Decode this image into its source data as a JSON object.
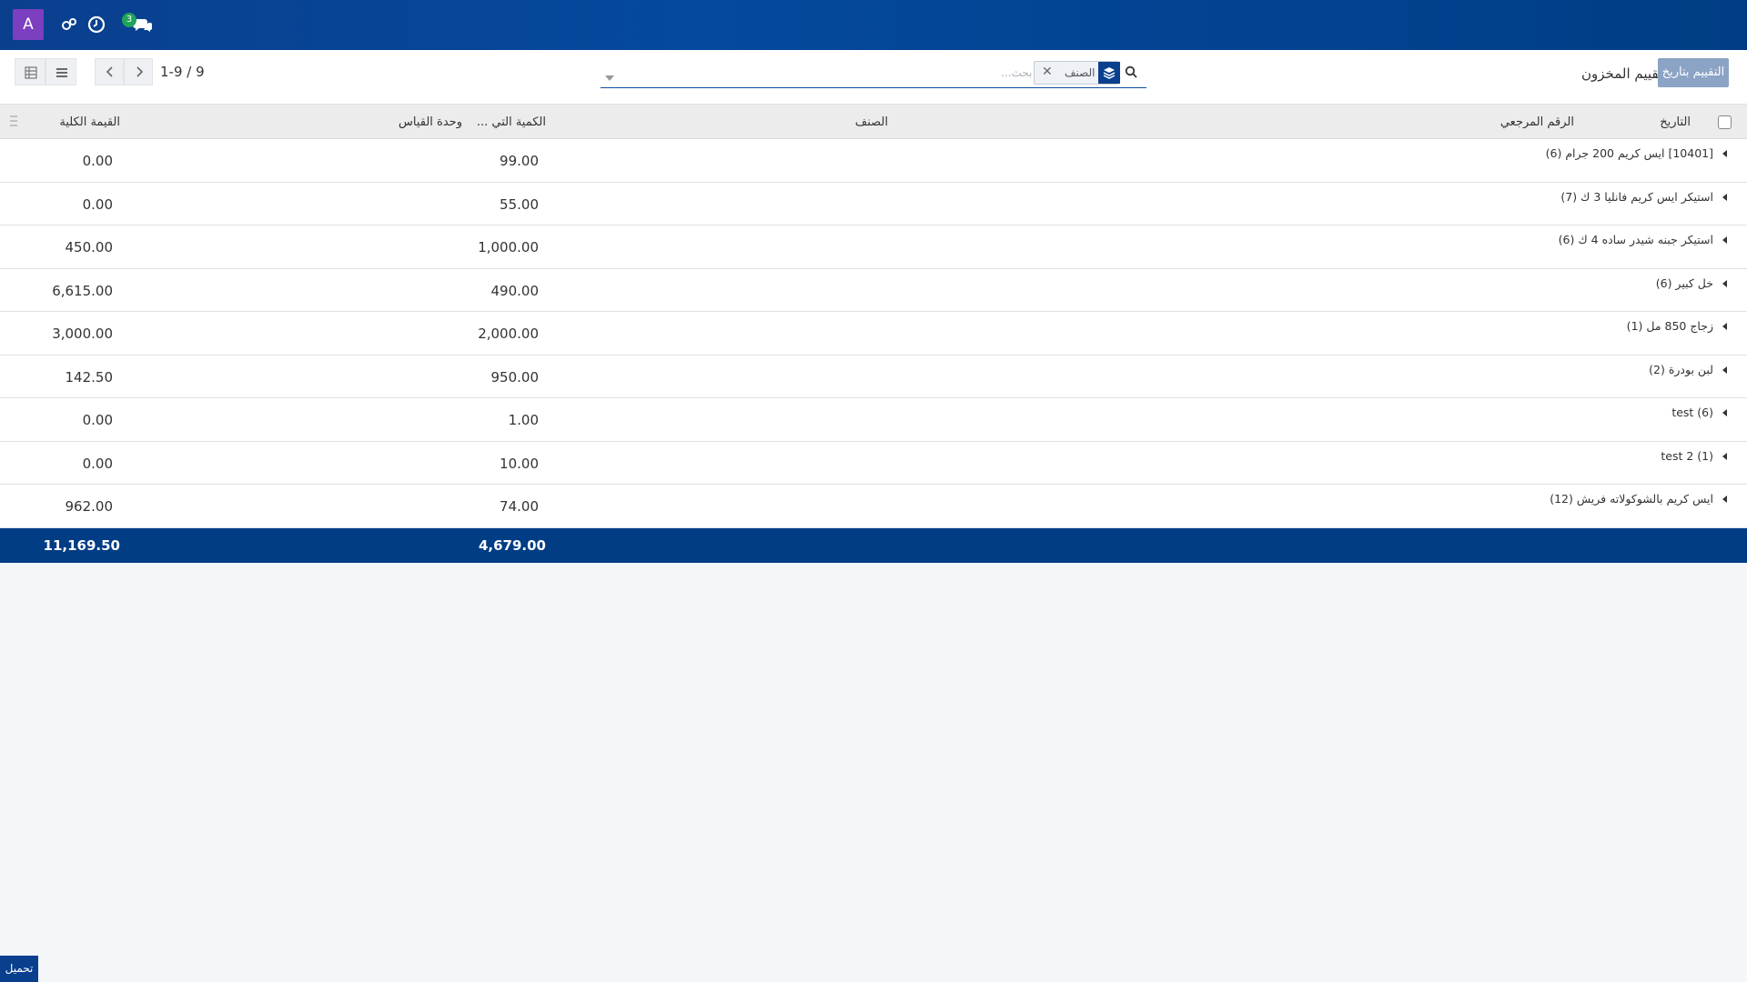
{
  "topbar": {
    "avatar_letter": "A",
    "chat_badge_count": "3",
    "icons": [
      "settings-gear-icon",
      "clock-icon",
      "chat-icon"
    ]
  },
  "controls": {
    "pager_text": "1-9 / 9",
    "search_placeholder": "بحث...",
    "facet_label": "الصنف",
    "page_title": "تقييم المخزون",
    "date_button_label": "التقييم بتاريخ"
  },
  "table": {
    "headers": {
      "date": "التاريخ",
      "reference": "الرقم المرجعي",
      "product": "الصنف",
      "quantity": "الكمية التي ...",
      "uom": "وحدة القياس",
      "total_value": "القيمة الكلية"
    },
    "rows": [
      {
        "label": "[10401] ايس كريم 200 جرام (6)",
        "quantity": "99.00",
        "value": "0.00"
      },
      {
        "label": "استيكر ايس كريم فانليا 3 ك (7)",
        "quantity": "55.00",
        "value": "0.00"
      },
      {
        "label": "استيكر جبنه شيدر ساده 4 ك (6)",
        "quantity": "1,000.00",
        "value": "450.00"
      },
      {
        "label": "خل كبير (6)",
        "quantity": "490.00",
        "value": "6,615.00"
      },
      {
        "label": "زجاج 850 مل (1)",
        "quantity": "2,000.00",
        "value": "3,000.00"
      },
      {
        "label": "لبن بودرة (2)",
        "quantity": "950.00",
        "value": "142.50"
      },
      {
        "label": "test (6)",
        "quantity": "1.00",
        "value": "0.00"
      },
      {
        "label": "test 2 (1)",
        "quantity": "10.00",
        "value": "0.00"
      },
      {
        "label": "ايس كريم بالشوكولاته فريش (12)",
        "quantity": "74.00",
        "value": "962.00"
      }
    ],
    "totals": {
      "quantity": "4,679.00",
      "value": "11,169.50"
    }
  },
  "bottom_button_label": "تحميل",
  "colors": {
    "topbar": "#04499d",
    "accent": "#0a3f8e",
    "avatar": "#7b3fbf",
    "badge": "#22a35a",
    "footer": "#003d85"
  }
}
